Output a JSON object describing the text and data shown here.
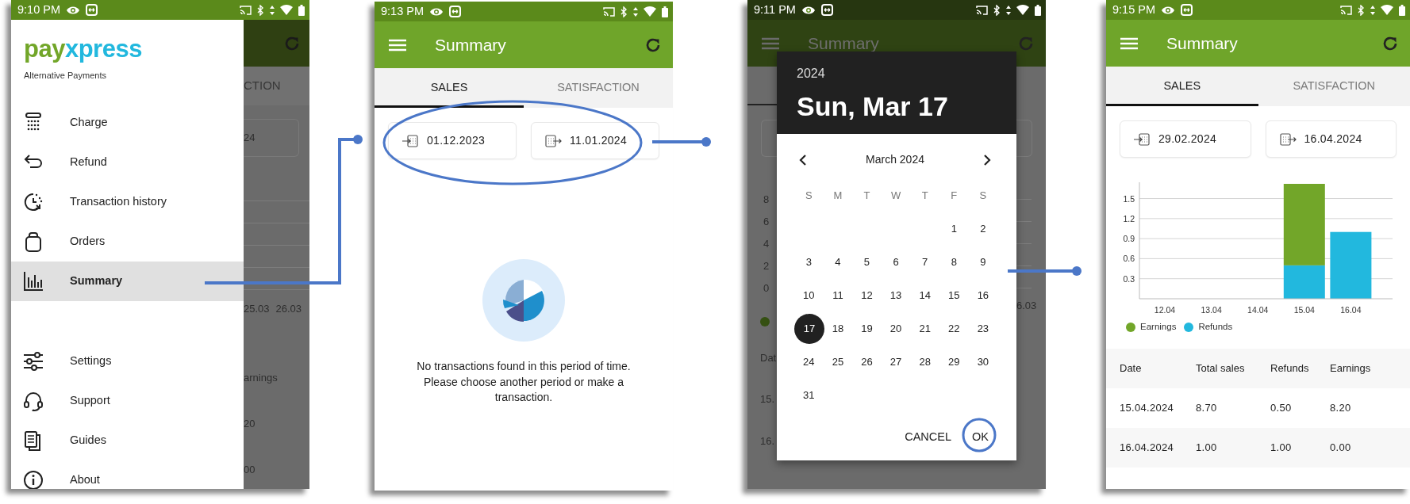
{
  "screens": [
    {
      "kind": "drawer",
      "status_bar": {
        "time": "9:10 PM"
      },
      "logo": [
        {
          "text": "pay",
          "color": "#72a629"
        },
        {
          "text": "xpress",
          "color": "#22b8de"
        }
      ],
      "tagline": "Alternative Payments",
      "items": [
        {
          "label": "Charge",
          "selected": false
        },
        {
          "label": "Refund",
          "selected": false
        },
        {
          "label": "Transaction history",
          "selected": false
        },
        {
          "label": "Orders",
          "selected": false
        },
        {
          "label": "Summary",
          "selected": true
        }
      ],
      "footer_items": [
        {
          "label": "Settings",
          "selected": false
        },
        {
          "label": "Support",
          "selected": false
        },
        {
          "label": "Guides",
          "selected": false
        },
        {
          "label": "About",
          "selected": false
        }
      ],
      "background": {
        "tab": "CTION",
        "date": "24",
        "axis_labels": [
          "25.03",
          "26.03"
        ],
        "column_heading": "arnings",
        "cells": [
          "20",
          "00"
        ]
      }
    },
    {
      "kind": "empty",
      "status_bar": {
        "time": "9:13 PM"
      },
      "title": "Summary",
      "tabs": [
        {
          "label": "SALES",
          "selected": true
        },
        {
          "label": "SATISFACTION",
          "selected": false
        }
      ],
      "date_from": "01.12.2023",
      "date_to": "11.01.2024",
      "message": "No transactions found in this period of time. Please choose another period or make a transaction."
    },
    {
      "kind": "date_picker",
      "status_bar": {
        "time": "9:11 PM"
      },
      "title": "Summary",
      "background": {
        "axis_labels": [
          "8",
          "6",
          "4",
          "2",
          "0"
        ],
        "column_heading": "Dat",
        "cells": [
          "15.",
          "16."
        ],
        "right_label": "6.03"
      },
      "dialog": {
        "year": "2024",
        "date": "Sun, Mar 17",
        "month": "March 2024",
        "weekdays": [
          "S",
          "M",
          "T",
          "W",
          "T",
          "F",
          "S"
        ],
        "weeks": [
          [
            {
              "day": "1",
              "selected": false
            },
            {
              "day": "2",
              "selected": false
            }
          ],
          [
            {
              "day": "3",
              "selected": false
            },
            {
              "day": "4",
              "selected": false
            },
            {
              "day": "5",
              "selected": false
            },
            {
              "day": "6",
              "selected": false
            },
            {
              "day": "7",
              "selected": false
            },
            {
              "day": "8",
              "selected": false
            },
            {
              "day": "9",
              "selected": false
            }
          ],
          [
            {
              "day": "10",
              "selected": false
            },
            {
              "day": "11",
              "selected": false
            },
            {
              "day": "12",
              "selected": false
            },
            {
              "day": "13",
              "selected": false
            },
            {
              "day": "14",
              "selected": false
            },
            {
              "day": "15",
              "selected": false
            },
            {
              "day": "16",
              "selected": false
            }
          ],
          [
            {
              "day": "17",
              "selected": true
            },
            {
              "day": "18",
              "selected": false
            },
            {
              "day": "19",
              "selected": false
            },
            {
              "day": "20",
              "selected": false
            },
            {
              "day": "21",
              "selected": false
            },
            {
              "day": "22",
              "selected": false
            },
            {
              "day": "23",
              "selected": false
            }
          ],
          [
            {
              "day": "24",
              "selected": false
            },
            {
              "day": "25",
              "selected": false
            },
            {
              "day": "26",
              "selected": false
            },
            {
              "day": "27",
              "selected": false
            },
            {
              "day": "28",
              "selected": false
            },
            {
              "day": "29",
              "selected": false
            },
            {
              "day": "30",
              "selected": false
            }
          ],
          [
            {
              "day": "31",
              "selected": false
            }
          ]
        ],
        "buttons": [
          "CANCEL",
          "OK"
        ]
      }
    },
    {
      "kind": "chart",
      "status_bar": {
        "time": "9:15 PM"
      },
      "title": "Summary",
      "tabs": [
        {
          "label": "SALES",
          "selected": true
        },
        {
          "label": "SATISFACTION",
          "selected": false
        }
      ],
      "date_from": "29.02.2024",
      "date_to": "16.04.2024",
      "chart_data": {
        "type": "bar",
        "stacked": true,
        "categories": [
          "12.04",
          "13.04",
          "14.04",
          "15.04",
          "16.04"
        ],
        "series": [
          {
            "name": "Refunds",
            "color": "#22b8de",
            "values": [
              0,
              0,
              0,
              0.5,
              1.0
            ]
          },
          {
            "name": "Earnings",
            "color": "#72a629",
            "values": [
              0,
              0,
              0,
              1.22,
              0
            ]
          }
        ],
        "grid": true,
        "ylim": [
          0,
          1.72
        ],
        "yticks": [
          0.3,
          0.6,
          0.9,
          1.2,
          1.5
        ]
      },
      "table": {
        "columns": [
          "Date",
          "Total sales",
          "Refunds",
          "Earnings"
        ],
        "rows": [
          [
            "15.04.2024",
            "8.70",
            "0.50",
            "8.20"
          ],
          [
            "16.04.2024",
            "1.00",
            "1.00",
            "0.00"
          ]
        ]
      }
    }
  ]
}
